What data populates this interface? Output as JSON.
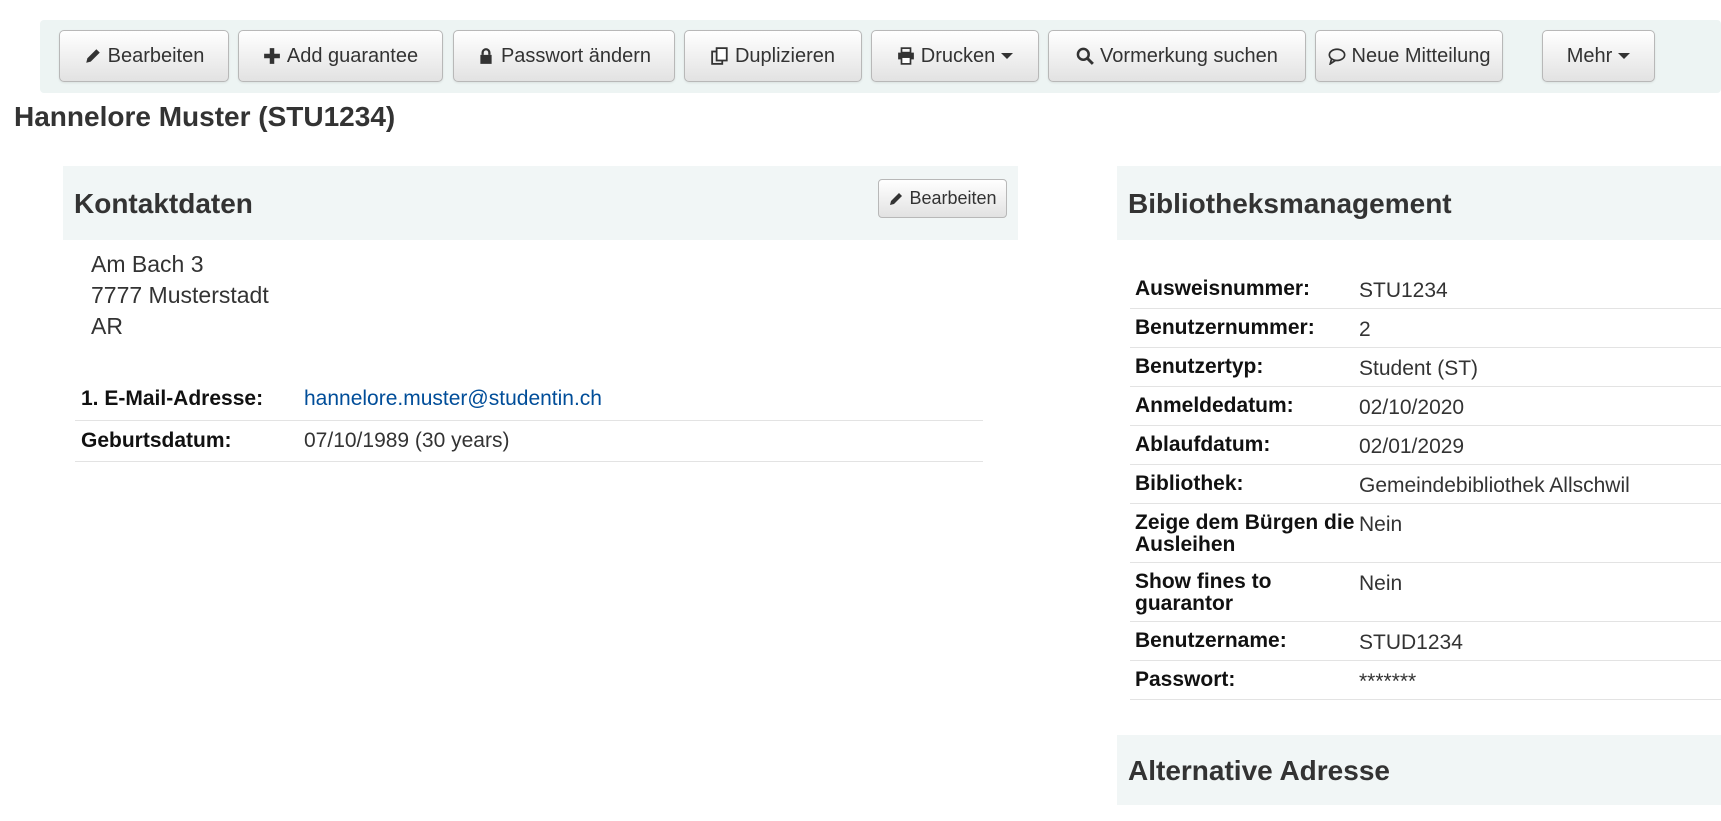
{
  "toolbar": {
    "buttons": [
      {
        "label": "Bearbeiten",
        "icon": "pencil-icon"
      },
      {
        "label": "Add guarantee",
        "icon": "plus-icon"
      },
      {
        "label": "Passwort ändern",
        "icon": "lock-icon"
      },
      {
        "label": "Duplizieren",
        "icon": "copy-icon"
      },
      {
        "label": "Drucken",
        "icon": "print-icon"
      },
      {
        "label": "Vormerkung suchen",
        "icon": "search-icon"
      },
      {
        "label": "Neue Mitteilung",
        "icon": "comment-icon"
      },
      {
        "label": "Mehr",
        "icon": "caret-down-icon"
      }
    ]
  },
  "patron": {
    "title": "Hannelore Muster (STU1234)"
  },
  "contact": {
    "heading": "Kontaktdaten",
    "edit_label": "Bearbeiten",
    "address": [
      "Am Bach 3",
      "7777 Musterstadt",
      "AR"
    ],
    "fields": [
      {
        "label": "1. E-Mail-Adresse:",
        "value": "hannelore.muster@studentin.ch"
      },
      {
        "label": "Geburtsdatum:",
        "value": "07/10/1989 (30 years)"
      }
    ]
  },
  "library": {
    "heading": "Bibliotheksmanagement",
    "fields": [
      {
        "label": "Ausweisnummer:",
        "value": "STU1234"
      },
      {
        "label": "Benutzernummer:",
        "value": "2"
      },
      {
        "label": "Benutzertyp:",
        "value": "Student (ST)"
      },
      {
        "label": "Anmeldedatum:",
        "value": "02/10/2020"
      },
      {
        "label": "Ablaufdatum:",
        "value": "02/01/2029"
      },
      {
        "label": "Bibliothek:",
        "value": "Gemeindebibliothek Allschwil"
      },
      {
        "label": "Zeige dem Bürgen die Ausleihen",
        "value": "Nein"
      },
      {
        "label": "Show fines to guarantor",
        "value": "Nein"
      },
      {
        "label": "Benutzername:",
        "value": "STUD1234"
      },
      {
        "label": "Passwort:",
        "value": "*******"
      }
    ]
  },
  "alternative": {
    "heading": "Alternative Adresse"
  },
  "colors": {
    "toolbar_bg": "#edf4f3",
    "panel_bg": "#f1f6f6",
    "link": "#004d99"
  }
}
